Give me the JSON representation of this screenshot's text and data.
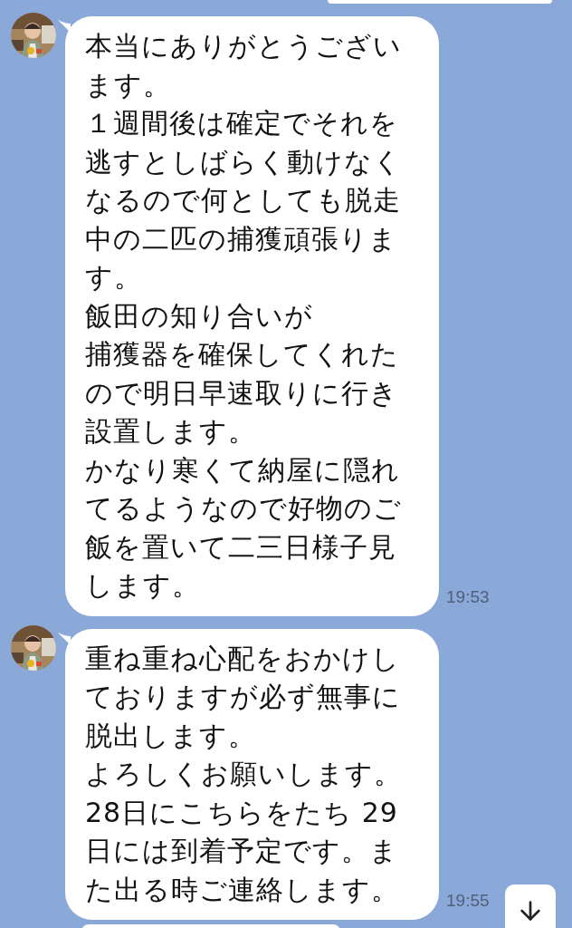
{
  "messages": [
    {
      "lines": [
        "本当にありがとうござい",
        "ます。",
        "１週間後は確定でそれを",
        "逃すとしばらく動けなく",
        "なるので何としても脱走",
        "中の二匹の捕獲頑張りま",
        "す。",
        "飯田の知り合いが",
        "捕獲器を確保してくれた",
        "ので明日早速取りに行き",
        "設置します。",
        "かなり寒くて納屋に隠れ",
        "てるようなので好物のご",
        "飯を置いて二三日様子見",
        "します。"
      ],
      "time": "19:53"
    },
    {
      "lines": [
        "重ね重ね心配をおかけし",
        "ておりますが必ず無事に",
        "脱出します。",
        "よろしくお願いします。",
        "28日にこちらをたち 29",
        "日には到着予定です。ま",
        "た出る時ご連絡します。"
      ],
      "time": "19:55"
    }
  ]
}
